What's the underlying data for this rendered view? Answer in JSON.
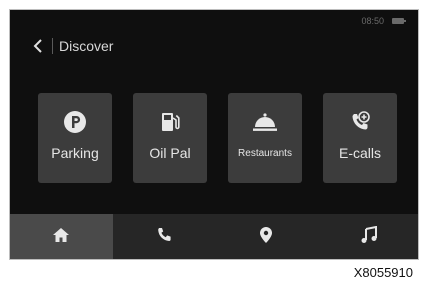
{
  "status": {
    "time": "08:50"
  },
  "header": {
    "title": "Discover"
  },
  "tiles": [
    {
      "label": "Parking",
      "icon": "parking-icon"
    },
    {
      "label": "Oil Pal",
      "icon": "fuel-pump-icon"
    },
    {
      "label": "Restaurants",
      "icon": "cloche-icon"
    },
    {
      "label": "E-calls",
      "icon": "emergency-call-icon"
    }
  ],
  "nav": {
    "items": [
      "home-icon",
      "phone-icon",
      "navigation-icon",
      "music-icon"
    ],
    "active": "home-icon"
  },
  "caption": "X8055910",
  "colors": {
    "screen_bg": "#0f0f0f",
    "tile_bg": "#3c3c3c",
    "nav_bg": "#262626",
    "nav_active_bg": "#4a4a4a",
    "icon": "#e8e8e8"
  }
}
